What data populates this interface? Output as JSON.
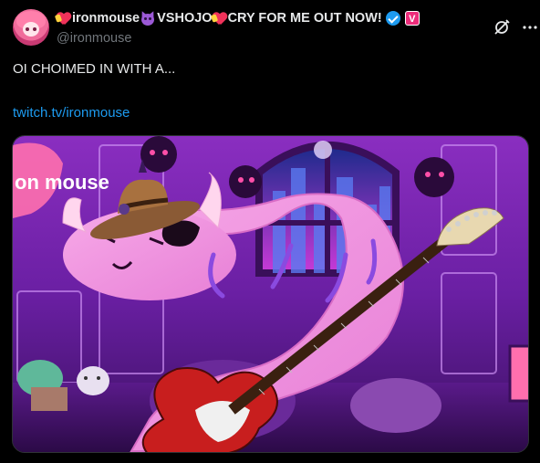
{
  "author": {
    "display_name": "ironmouse",
    "display_name_suffix": "VSHOJO",
    "display_name_tail": "CRY FOR ME OUT NOW!",
    "handle": "@ironmouse",
    "affiliate_badge": "V",
    "emoji_icons": [
      "heart-with-ribbon",
      "smiling-devil",
      "heart-with-ribbon"
    ]
  },
  "tweet": {
    "text": "OI CHOIMED IN WITH A...",
    "link_text": "twitch.tv/ironmouse"
  },
  "media": {
    "overlay_logo_text": "on mouse"
  },
  "colors": {
    "background": "#000000",
    "text": "#e7e9ea",
    "muted": "#71767b",
    "link": "#1d9bf0",
    "verified": "#1d9bf0",
    "affiliate": "#ec2c7a"
  }
}
